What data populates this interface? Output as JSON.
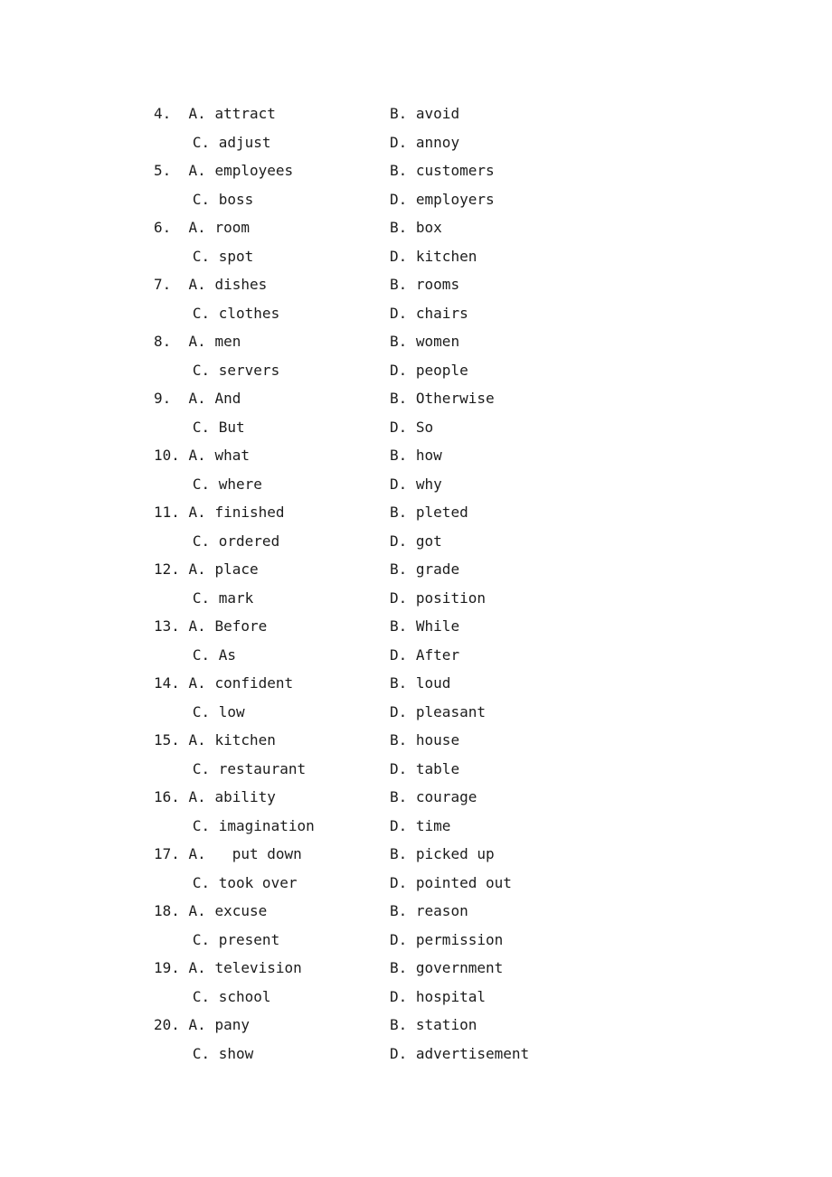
{
  "document": {
    "type": "multiple-choice-answer-options",
    "page_background": "#ffffff",
    "text_color": "#1c1c1c",
    "first_question_number": 4,
    "last_question_number": 20
  },
  "questions": [
    {
      "number": "4.",
      "a_label": "A.",
      "a_text": "attract",
      "b_label": "B.",
      "b_text": "avoid",
      "c_label": "C.",
      "c_text": "adjust",
      "d_label": "D.",
      "d_text": "annoy"
    },
    {
      "number": "5.",
      "a_label": "A.",
      "a_text": "employees",
      "b_label": "B.",
      "b_text": "customers",
      "c_label": "C.",
      "c_text": "boss",
      "d_label": "D.",
      "d_text": "employers"
    },
    {
      "number": "6.",
      "a_label": "A.",
      "a_text": "room",
      "b_label": "B.",
      "b_text": "box",
      "c_label": "C.",
      "c_text": "spot",
      "d_label": "D.",
      "d_text": "kitchen"
    },
    {
      "number": "7.",
      "a_label": "A.",
      "a_text": "dishes",
      "b_label": "B.",
      "b_text": "rooms",
      "c_label": "C.",
      "c_text": "clothes",
      "d_label": "D.",
      "d_text": "chairs"
    },
    {
      "number": "8.",
      "a_label": "A.",
      "a_text": "men",
      "b_label": "B.",
      "b_text": "women",
      "c_label": "C.",
      "c_text": "servers",
      "d_label": "D.",
      "d_text": "people"
    },
    {
      "number": "9.",
      "a_label": "A.",
      "a_text": "And",
      "b_label": "B.",
      "b_text": "Otherwise",
      "c_label": "C.",
      "c_text": "But",
      "d_label": "D.",
      "d_text": "So"
    },
    {
      "number": "10.",
      "a_label": "A.",
      "a_text": "what",
      "b_label": "B.",
      "b_text": "how",
      "c_label": "C.",
      "c_text": "where",
      "d_label": "D.",
      "d_text": "why"
    },
    {
      "number": "11.",
      "a_label": "A.",
      "a_text": "finished",
      "b_label": "B.",
      "b_text": "pleted",
      "c_label": "C.",
      "c_text": "ordered",
      "d_label": "D.",
      "d_text": "got"
    },
    {
      "number": "12.",
      "a_label": "A.",
      "a_text": "place",
      "b_label": "B.",
      "b_text": "grade",
      "c_label": "C.",
      "c_text": "mark",
      "d_label": "D.",
      "d_text": "position"
    },
    {
      "number": "13.",
      "a_label": "A.",
      "a_text": "Before",
      "b_label": "B.",
      "b_text": "While",
      "c_label": "C.",
      "c_text": "As",
      "d_label": "D.",
      "d_text": "After"
    },
    {
      "number": "14.",
      "a_label": "A.",
      "a_text": "confident",
      "b_label": "B.",
      "b_text": "loud",
      "c_label": "C.",
      "c_text": "low",
      "d_label": "D.",
      "d_text": "pleasant"
    },
    {
      "number": "15.",
      "a_label": "A.",
      "a_text": "kitchen",
      "b_label": "B.",
      "b_text": "house",
      "c_label": "C.",
      "c_text": "restaurant",
      "d_label": "D.",
      "d_text": "table"
    },
    {
      "number": "16.",
      "a_label": "A.",
      "a_text": "ability",
      "b_label": "B.",
      "b_text": "courage",
      "c_label": "C.",
      "c_text": "imagination",
      "d_label": "D.",
      "d_text": "time"
    },
    {
      "number": "17.",
      "a_label": "A.",
      "a_text": "  put down",
      "b_label": "B.",
      "b_text": "picked up",
      "c_label": "C.",
      "c_text": "took over",
      "d_label": "D.",
      "d_text": "pointed out"
    },
    {
      "number": "18.",
      "a_label": "A.",
      "a_text": "excuse",
      "b_label": "B.",
      "b_text": "reason",
      "c_label": "C.",
      "c_text": "present",
      "d_label": "D.",
      "d_text": "permission"
    },
    {
      "number": "19.",
      "a_label": "A.",
      "a_text": "television",
      "b_label": "B.",
      "b_text": "government",
      "c_label": "C.",
      "c_text": "school",
      "d_label": "D.",
      "d_text": "hospital"
    },
    {
      "number": "20.",
      "a_label": "A.",
      "a_text": "pany",
      "b_label": "B.",
      "b_text": "station",
      "c_label": "C.",
      "c_text": "show",
      "d_label": "D.",
      "d_text": "advertisement"
    }
  ]
}
